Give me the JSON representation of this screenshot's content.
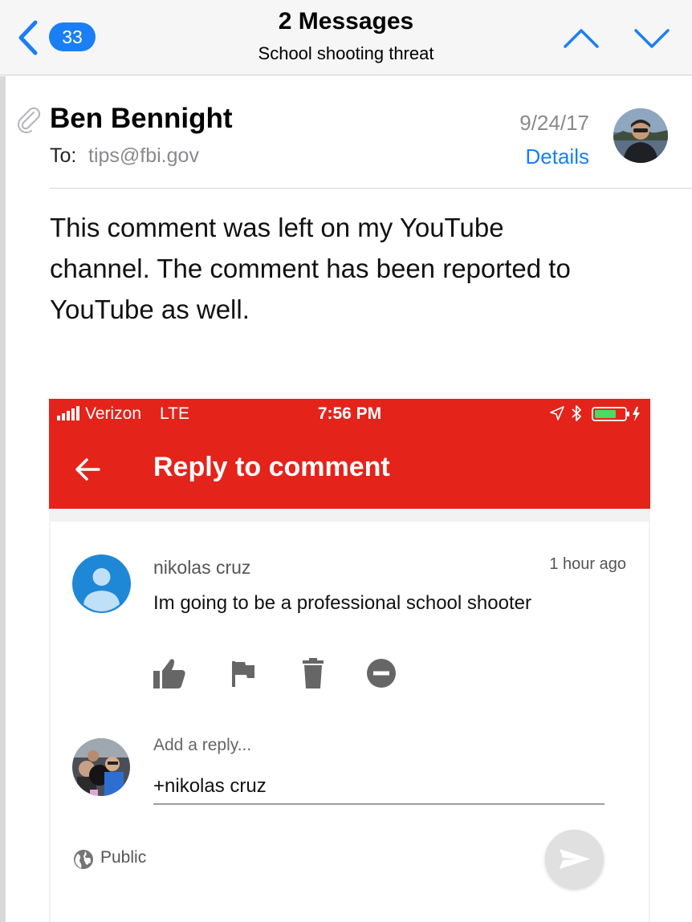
{
  "nav": {
    "unread_count": "33",
    "title": "2 Messages",
    "subtitle": "School shooting threat"
  },
  "message": {
    "sender": "Ben Bennight",
    "to_label": "To:",
    "to_address": "tips@fbi.gov",
    "date": "9/24/17",
    "details_label": "Details",
    "body": "This comment was left on my YouTube\nchannel.  The comment has been reported to\nYouTube as well."
  },
  "embedded_screenshot": {
    "status_bar": {
      "carrier": "Verizon",
      "network": "LTE",
      "time": "7:56 PM"
    },
    "app_bar": {
      "title": "Reply to comment"
    },
    "comment": {
      "author": "nikolas cruz",
      "time": "1 hour ago",
      "text": "Im going to be a professional school shooter",
      "actions": [
        "like-icon",
        "flag-icon",
        "trash-icon",
        "remove-icon"
      ]
    },
    "reply": {
      "label": "Add a reply...",
      "value": "+nikolas cruz",
      "privacy": "Public"
    }
  },
  "colors": {
    "ios_blue": "#1a7ff5",
    "youtube_red": "#e4231b",
    "battery_green": "#4cd964"
  }
}
